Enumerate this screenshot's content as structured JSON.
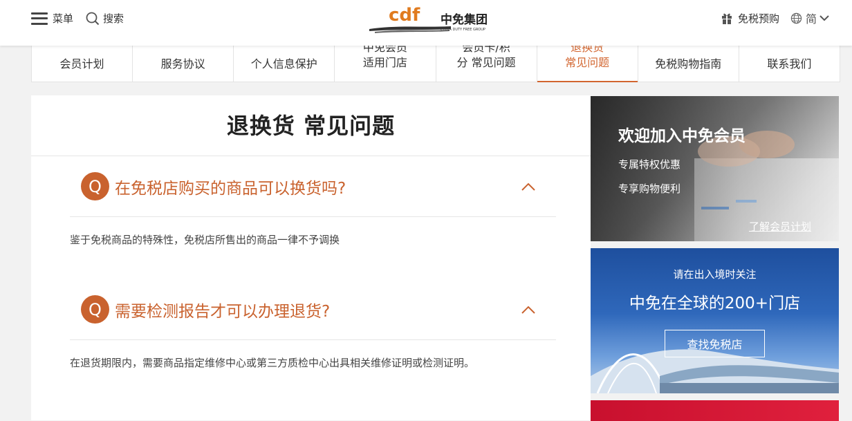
{
  "header": {
    "menu_label": "菜单",
    "search_label": "搜索",
    "logo_mark": "cdf",
    "logo_name": "中免集团",
    "logo_sub": "CHINA DUTY FREE GROUP",
    "preorder_label": "免税预购",
    "language_label": "简"
  },
  "tabs": [
    {
      "line1": "会员计划",
      "line2": ""
    },
    {
      "line1": "服务协议",
      "line2": ""
    },
    {
      "line1": "个人信息保护",
      "line2": ""
    },
    {
      "line1": "中免会员",
      "line2": "适用门店"
    },
    {
      "line1": "会员卡/积",
      "line2": "分 常见问题"
    },
    {
      "line1": "退换货",
      "line2": "常见问题",
      "active": true
    },
    {
      "line1": "免税购物指南",
      "line2": ""
    },
    {
      "line1": "联系我们",
      "line2": ""
    }
  ],
  "main": {
    "title": "退换货 常见问题",
    "faqs": [
      {
        "badge": "Q",
        "question": "在免税店购买的商品可以换货吗?",
        "answer": "鉴于免税商品的特殊性，免税店所售出的商品一律不予调换"
      },
      {
        "badge": "Q",
        "question": "需要检测报告才可以办理退货?",
        "answer": "在退货期限内，需要商品指定维修中心或第三方质检中心出具相关维修证明或检测证明。"
      }
    ]
  },
  "sidebar": {
    "member": {
      "heading": "欢迎加入中免会员",
      "perk1": "专属特权优惠",
      "perk2": "专享购物便利",
      "link": "了解会员计划"
    },
    "stores": {
      "subtitle": "请在出入境时关注",
      "heading": "中免在全球的200+门店",
      "button": "查找免税店"
    }
  },
  "colors": {
    "accent": "#d2652f",
    "badge": "#c9622e"
  }
}
